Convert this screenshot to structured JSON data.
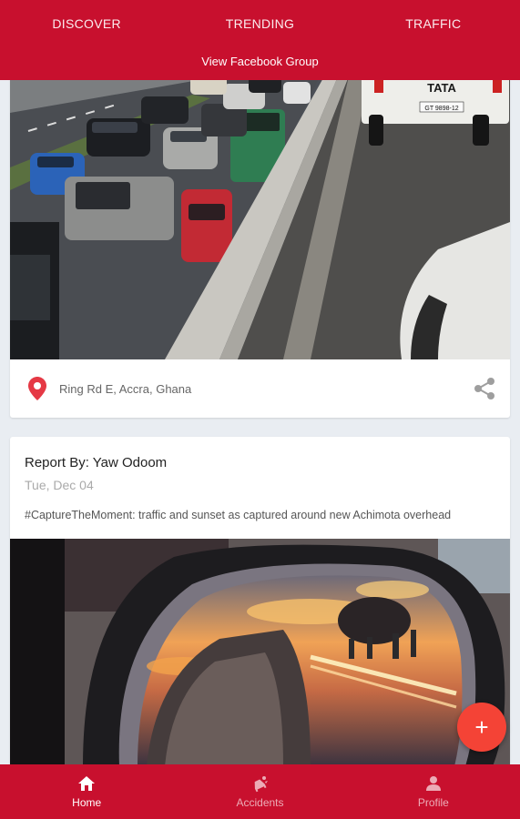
{
  "header": {
    "tabs": [
      {
        "label": "DISCOVER"
      },
      {
        "label": "TRENDING"
      },
      {
        "label": "TRAFFIC"
      }
    ],
    "facebook_link": "View Facebook Group"
  },
  "posts": [
    {
      "location": "Ring Rd E, Accra, Ghana",
      "truck_brand": "TATA",
      "truck_plate": "GT 9898-12",
      "icons": [
        "location-pin-icon",
        "share-icon"
      ]
    },
    {
      "reporter": "Report By: Yaw Odoom",
      "date": "Tue, Dec 04",
      "caption": "#CaptureTheMoment: traffic and sunset as captured around new Achimota overhead"
    }
  ],
  "fab": {
    "icon": "plus-icon",
    "label": "+"
  },
  "bottom_nav": [
    {
      "label": "Home",
      "icon": "home-icon",
      "active": true
    },
    {
      "label": "Accidents",
      "icon": "car-crash-icon",
      "active": false
    },
    {
      "label": "Profile",
      "icon": "person-icon",
      "active": false
    }
  ],
  "colors": {
    "brand_red": "#c8102e",
    "fab_red": "#f44336",
    "pin_red": "#e53945",
    "background": "#e9edf2"
  }
}
